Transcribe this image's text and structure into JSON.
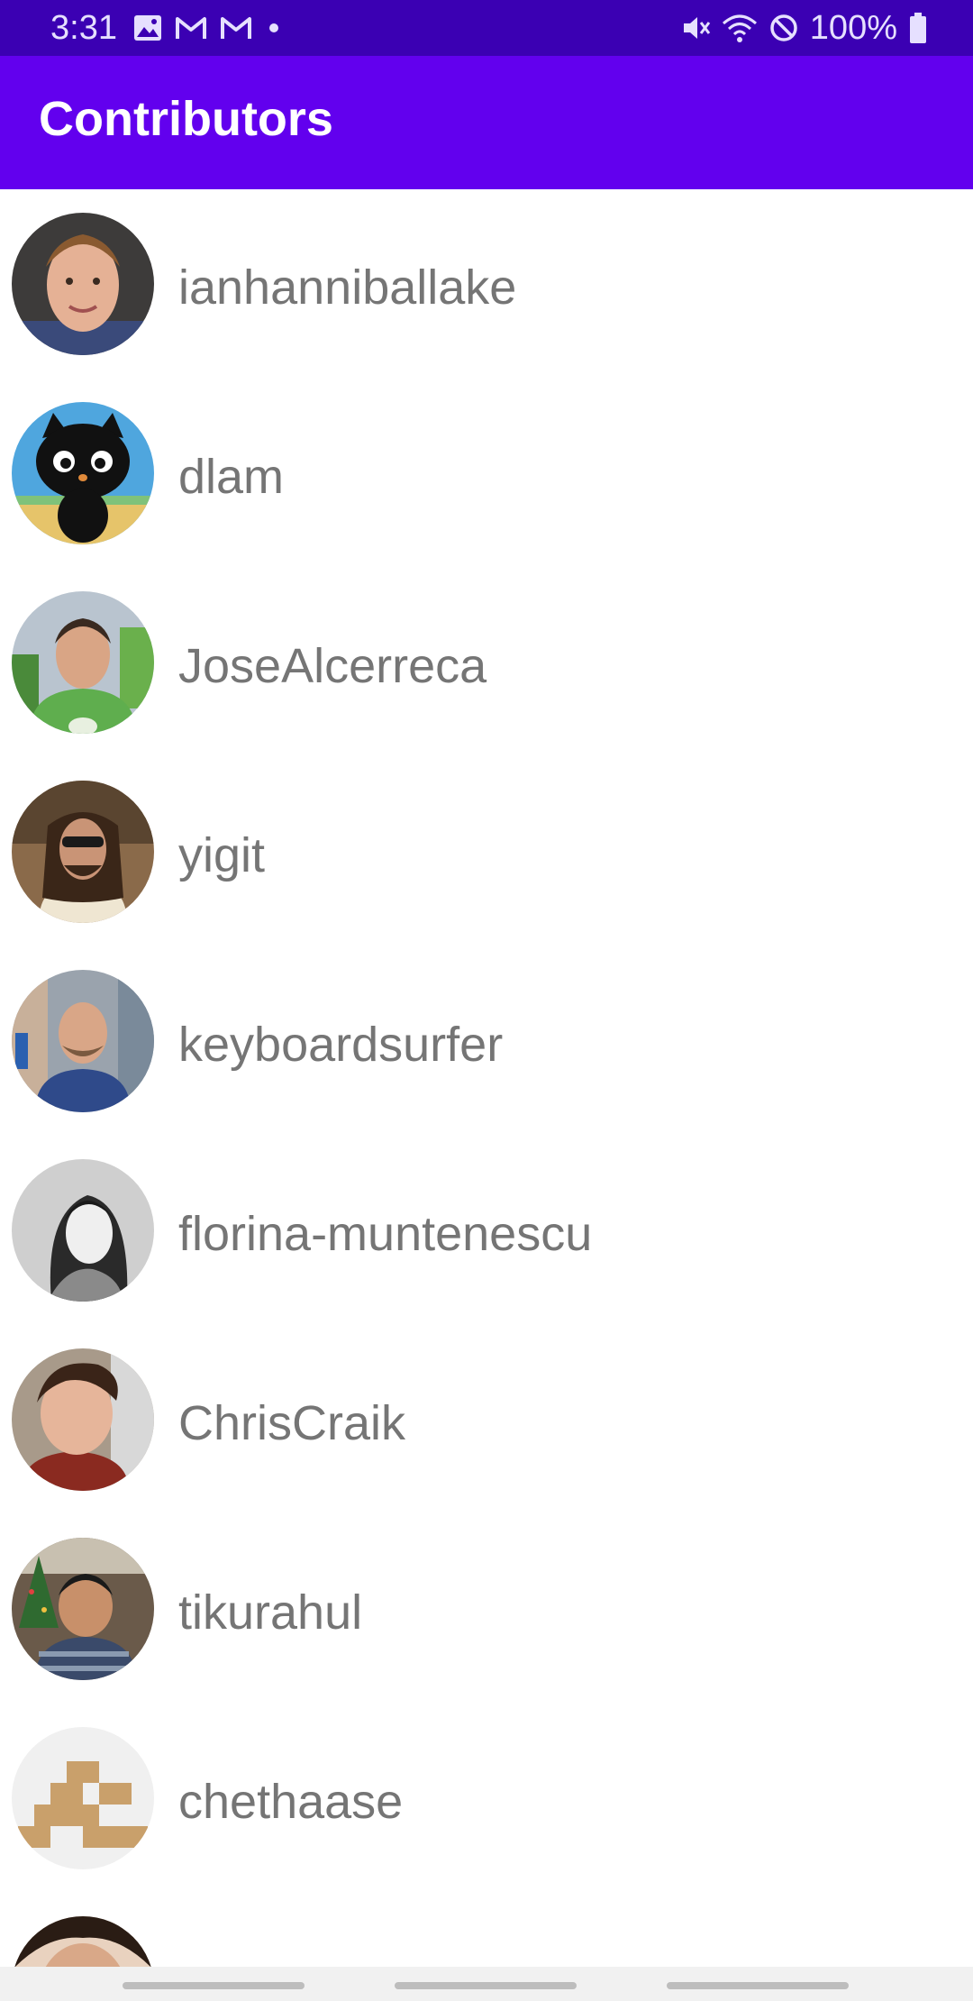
{
  "status_bar": {
    "time": "3:31",
    "battery": "100%",
    "left_icons": [
      "image-icon",
      "gmail-icon",
      "gmail-icon",
      "dot-icon"
    ],
    "right_icons": [
      "mute-icon",
      "wifi-icon",
      "do-not-disturb-icon",
      "battery-icon"
    ]
  },
  "app_bar": {
    "title": "Contributors",
    "color": "#6200ee"
  },
  "contributors": [
    {
      "login": "ianhanniballake"
    },
    {
      "login": "dlam"
    },
    {
      "login": "JoseAlcerreca"
    },
    {
      "login": "yigit"
    },
    {
      "login": "keyboardsurfer"
    },
    {
      "login": "florina-muntenescu"
    },
    {
      "login": "ChrisCraik"
    },
    {
      "login": "tikurahul"
    },
    {
      "login": "chethaase"
    },
    {
      "login": ""
    }
  ]
}
